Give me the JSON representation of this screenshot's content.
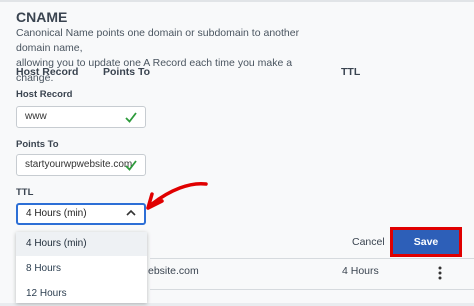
{
  "section": {
    "title": "CNAME",
    "description_line1": "Canonical Name points one domain or subdomain to another domain name,",
    "description_line2": "allowing you to update one A Record each time you make a change."
  },
  "table_header": {
    "host_record": "Host Record",
    "points_to": "Points To",
    "ttl": "TTL"
  },
  "form": {
    "host_record_label": "Host Record",
    "host_record_value": "www",
    "points_to_label": "Points To",
    "points_to_value": "startyourwpwebsite.com",
    "ttl_label": "TTL",
    "ttl_value": "4 Hours (min)"
  },
  "ttl_options": [
    "4 Hours (min)",
    "8 Hours",
    "12 Hours"
  ],
  "actions": {
    "cancel": "Cancel",
    "save": "Save"
  },
  "record_row": {
    "points_to_partial": "ebsite.com",
    "ttl": "4 Hours"
  },
  "colors": {
    "accent": "#2d5fb8",
    "highlight": "#e00000",
    "check": "#2e9b3c"
  },
  "icons": {
    "valid": "check-icon",
    "collapse": "chevron-up-icon",
    "menu": "kebab-menu-icon",
    "annotation": "red-arrow-icon"
  }
}
